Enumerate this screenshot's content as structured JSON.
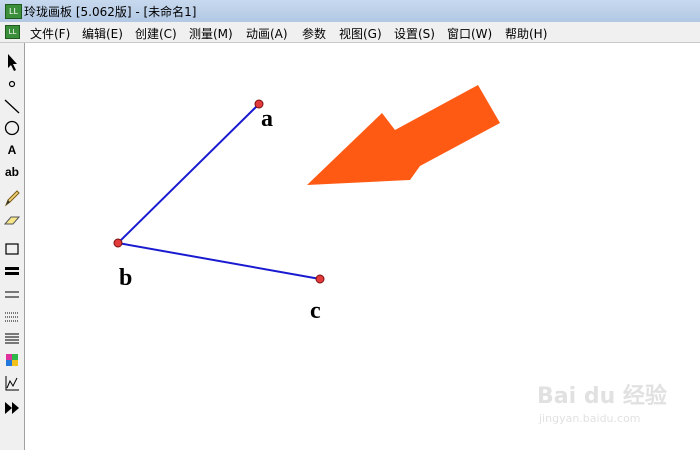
{
  "window": {
    "title": "玲珑画板 [5.062版] - [未命名1]"
  },
  "menu": [
    "文件(F)",
    "编辑(E)",
    "创建(C)",
    "测量(M)",
    "动画(A)",
    "参数",
    "视图(G)",
    "设置(S)",
    "窗口(W)",
    "帮助(H)"
  ],
  "toolbar": {
    "text_tool": "A",
    "label_tool": "ab"
  },
  "canvas": {
    "points": [
      {
        "label": "a"
      },
      {
        "label": "b"
      },
      {
        "label": "c"
      }
    ],
    "segments": [
      [
        "a",
        "b"
      ],
      [
        "b",
        "c"
      ]
    ],
    "point_color": "#e23b3b",
    "segment_color": "#1a1ad0",
    "arrow_color": "#ff5a14"
  },
  "watermark": {
    "main": "Bai du 经验",
    "sub": "jingyan.baidu.com"
  }
}
